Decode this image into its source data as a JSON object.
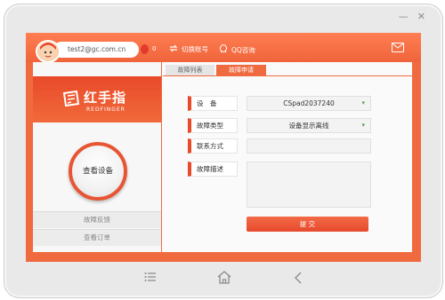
{
  "window": {
    "minimize": "—",
    "close": "✕"
  },
  "header": {
    "email": "test2@gc.com.cn",
    "count": "0",
    "switch_label": "切换账号",
    "qq_label": "QQ咨询"
  },
  "brand": {
    "name": "红手指",
    "sub": "REDFINGER"
  },
  "left": {
    "view_device": "查看设备",
    "items": [
      {
        "label": "故障反馈"
      },
      {
        "label": "查看订单"
      }
    ]
  },
  "tabs": [
    {
      "label": "故障列表"
    },
    {
      "label": "故障申请"
    }
  ],
  "form": {
    "device_label": "设　备",
    "device_value": "CSpad2037240",
    "type_label": "故障类型",
    "type_value": "设备显示离线",
    "contact_label": "联系方式",
    "contact_value": "",
    "desc_label": "故障描述",
    "desc_value": "",
    "submit": "提 交"
  },
  "colors": {
    "accent": "#f06a3f",
    "brand_dark": "#e84a2a"
  },
  "icons": [
    "menu-icon",
    "home-icon",
    "back-icon",
    "mail-icon",
    "switch-icon",
    "qq-icon",
    "balloon-icon"
  ]
}
